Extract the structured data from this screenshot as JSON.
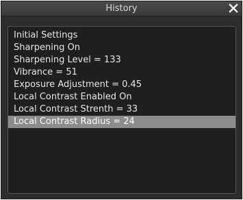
{
  "window": {
    "title": "History",
    "close_icon": "close-icon"
  },
  "history": {
    "items": [
      {
        "label": "Initial Settings"
      },
      {
        "label": "Sharpening On"
      },
      {
        "label": "Sharpening Level = 133"
      },
      {
        "label": "Vibrance = 51"
      },
      {
        "label": "Exposure Adjustment = 0.45"
      },
      {
        "label": "Local Contrast Enabled On"
      },
      {
        "label": "Local Contrast Strenth = 33"
      },
      {
        "label": "Local Contrast Radius = 24"
      }
    ],
    "selected_index": 7
  },
  "colors": {
    "background": "#2d2d2d",
    "list_background": "#1f1f1f",
    "selection": "#8c8c8c",
    "text": "#e6e6e6"
  }
}
